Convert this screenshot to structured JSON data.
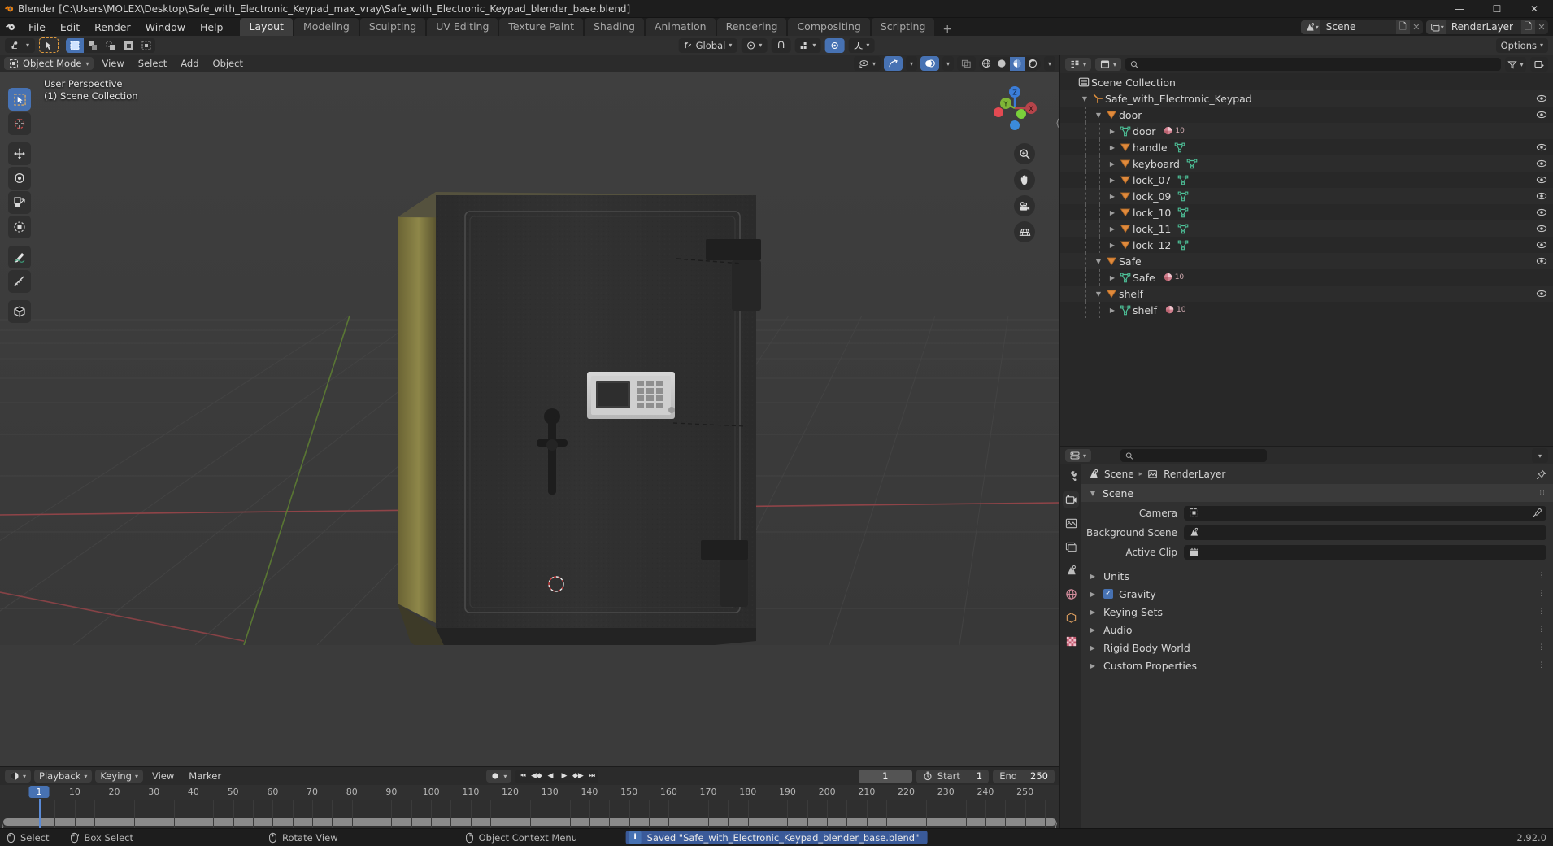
{
  "window": {
    "title": "Blender [C:\\Users\\MOLEX\\Desktop\\Safe_with_Electronic_Keypad_max_vray\\Safe_with_Electronic_Keypad_blender_base.blend]",
    "minimize": "—",
    "maximize": "☐",
    "close": "✕"
  },
  "topbar": {
    "menus": [
      "File",
      "Edit",
      "Render",
      "Window",
      "Help"
    ],
    "workspaces": [
      {
        "label": "Layout",
        "active": true
      },
      {
        "label": "Modeling",
        "active": false
      },
      {
        "label": "Sculpting",
        "active": false
      },
      {
        "label": "UV Editing",
        "active": false
      },
      {
        "label": "Texture Paint",
        "active": false
      },
      {
        "label": "Shading",
        "active": false
      },
      {
        "label": "Animation",
        "active": false
      },
      {
        "label": "Rendering",
        "active": false
      },
      {
        "label": "Compositing",
        "active": false
      },
      {
        "label": "Scripting",
        "active": false
      }
    ],
    "add_workspace": "+",
    "scene_name": "Scene",
    "viewlayer_name": "RenderLayer"
  },
  "tool_header": {
    "transform_orientation": "Global",
    "options_label": "Options"
  },
  "viewport": {
    "mode": "Object Mode",
    "menus": [
      "View",
      "Select",
      "Add",
      "Object"
    ],
    "overlay_line1": "User Perspective",
    "overlay_line2": "(1) Scene Collection",
    "gizmo_axes": {
      "x": "X",
      "y": "Y",
      "z": "Z"
    }
  },
  "outliner": {
    "search_placeholder": "",
    "rows": [
      {
        "name": "Scene Collection",
        "depth": 0,
        "icon": "collection-icon",
        "tri": "",
        "eye": false,
        "mesh_ind": false,
        "users": ""
      },
      {
        "name": "Safe_with_Electronic_Keypad",
        "depth": 1,
        "icon": "empty-axis-icon",
        "tri": "down",
        "eye": true,
        "mesh_ind": false,
        "users": ""
      },
      {
        "name": "door",
        "depth": 2,
        "icon": "mesh-object-icon",
        "tri": "down",
        "eye": true,
        "mesh_ind": false,
        "users": ""
      },
      {
        "name": "door",
        "depth": 3,
        "icon": "mesh-data-icon",
        "tri": "right",
        "eye": false,
        "mesh_ind": false,
        "users": "10"
      },
      {
        "name": "handle",
        "depth": 3,
        "icon": "mesh-object-icon",
        "tri": "right",
        "eye": true,
        "mesh_ind": true,
        "users": ""
      },
      {
        "name": "keyboard",
        "depth": 3,
        "icon": "mesh-object-icon",
        "tri": "right",
        "eye": true,
        "mesh_ind": true,
        "users": ""
      },
      {
        "name": "lock_07",
        "depth": 3,
        "icon": "mesh-object-icon",
        "tri": "right",
        "eye": true,
        "mesh_ind": true,
        "users": ""
      },
      {
        "name": "lock_09",
        "depth": 3,
        "icon": "mesh-object-icon",
        "tri": "right",
        "eye": true,
        "mesh_ind": true,
        "users": ""
      },
      {
        "name": "lock_10",
        "depth": 3,
        "icon": "mesh-object-icon",
        "tri": "right",
        "eye": true,
        "mesh_ind": true,
        "users": ""
      },
      {
        "name": "lock_11",
        "depth": 3,
        "icon": "mesh-object-icon",
        "tri": "right",
        "eye": true,
        "mesh_ind": true,
        "users": ""
      },
      {
        "name": "lock_12",
        "depth": 3,
        "icon": "mesh-object-icon",
        "tri": "right",
        "eye": true,
        "mesh_ind": true,
        "users": ""
      },
      {
        "name": "Safe",
        "depth": 2,
        "icon": "mesh-object-icon",
        "tri": "down",
        "eye": true,
        "mesh_ind": false,
        "users": ""
      },
      {
        "name": "Safe",
        "depth": 3,
        "icon": "mesh-data-icon",
        "tri": "right",
        "eye": false,
        "mesh_ind": false,
        "users": "10"
      },
      {
        "name": "shelf",
        "depth": 2,
        "icon": "mesh-object-icon",
        "tri": "down",
        "eye": true,
        "mesh_ind": false,
        "users": ""
      },
      {
        "name": "shelf",
        "depth": 3,
        "icon": "mesh-data-icon",
        "tri": "right",
        "eye": false,
        "mesh_ind": false,
        "users": "10"
      }
    ]
  },
  "properties": {
    "search_placeholder": "",
    "breadcrumb": {
      "scene": "Scene",
      "viewlayer": "RenderLayer"
    },
    "panel_title": "Scene",
    "fields": [
      {
        "label": "Camera",
        "value": "",
        "icon": "camera-icon"
      },
      {
        "label": "Background Scene",
        "value": "",
        "icon": "scene-icon"
      },
      {
        "label": "Active Clip",
        "value": "",
        "icon": "clip-icon"
      }
    ],
    "sections": [
      {
        "label": "Units",
        "checkbox": false
      },
      {
        "label": "Gravity",
        "checkbox": true
      },
      {
        "label": "Keying Sets",
        "checkbox": false
      },
      {
        "label": "Audio",
        "checkbox": false
      },
      {
        "label": "Rigid Body World",
        "checkbox": false
      },
      {
        "label": "Custom Properties",
        "checkbox": false
      }
    ]
  },
  "timeline": {
    "menus": [
      "View",
      "Marker"
    ],
    "playback_label": "Playback",
    "keying_label": "Keying",
    "current_frame": "1",
    "start_label": "Start",
    "start_value": "1",
    "end_label": "End",
    "end_value": "250",
    "playhead_frame": "1",
    "ticks": [
      "10",
      "20",
      "30",
      "40",
      "50",
      "60",
      "70",
      "80",
      "90",
      "100",
      "110",
      "120",
      "130",
      "140",
      "150",
      "160",
      "170",
      "180",
      "190",
      "200",
      "210",
      "220",
      "230",
      "240",
      "250"
    ]
  },
  "statusbar": {
    "items": [
      {
        "label": "Select",
        "mouse": "left"
      },
      {
        "label": "Box Select",
        "mouse": "left-drag"
      },
      {
        "label": "Rotate View",
        "mouse": "middle"
      },
      {
        "label": "Object Context Menu",
        "mouse": "right"
      }
    ],
    "report": "Saved \"Safe_with_Electronic_Keypad_blender_base.blend\"",
    "version": "2.92.0"
  },
  "colors": {
    "accent_blue": "#4772b3",
    "orange": "#e09b3d",
    "mesh_green": "#4ec49a",
    "axis_x": "#b5444a",
    "axis_y": "#7fb537",
    "axis_z": "#3b7dd8"
  }
}
